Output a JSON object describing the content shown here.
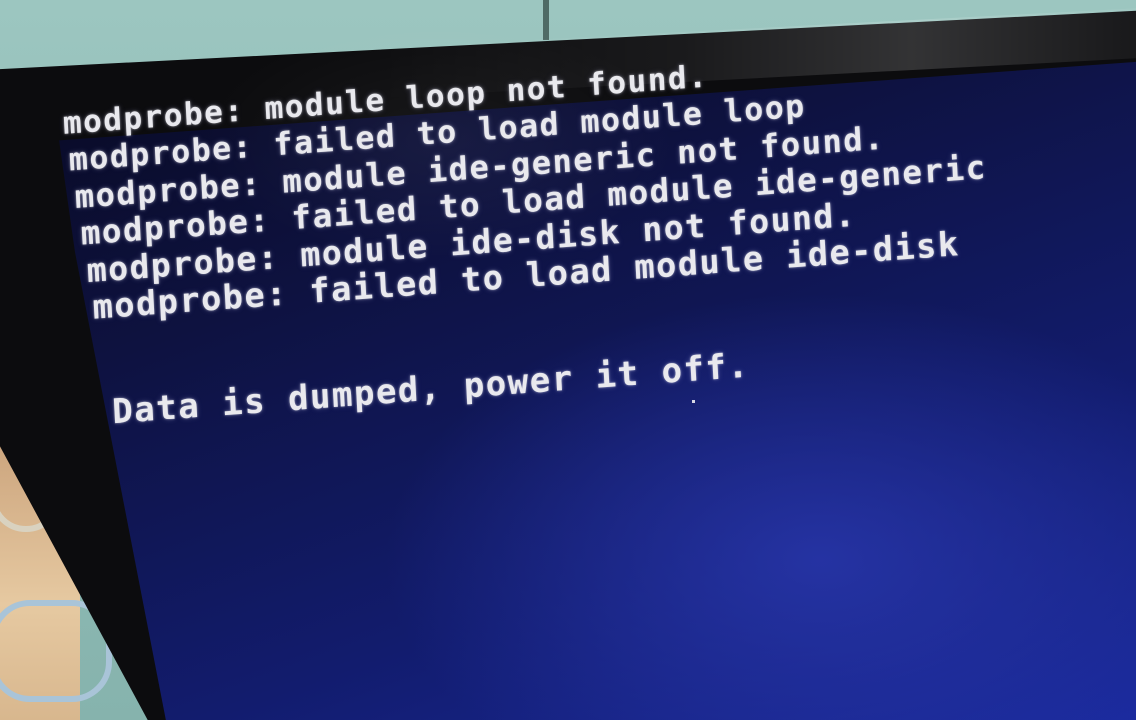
{
  "terminal": {
    "lines": [
      "modprobe: module loop not found.",
      "modprobe: failed to load module loop",
      "modprobe: module ide-generic not found.",
      "modprobe: failed to load module ide-generic",
      "modprobe: module ide-disk not found.",
      "modprobe: failed to load module ide-disk"
    ],
    "final_message": "Data is dumped, power it off."
  },
  "colors": {
    "screen_background": "#121c6e",
    "text": "#e9e9ee",
    "bezel": "#0c0c0e",
    "wall": "#9cc6c0"
  }
}
